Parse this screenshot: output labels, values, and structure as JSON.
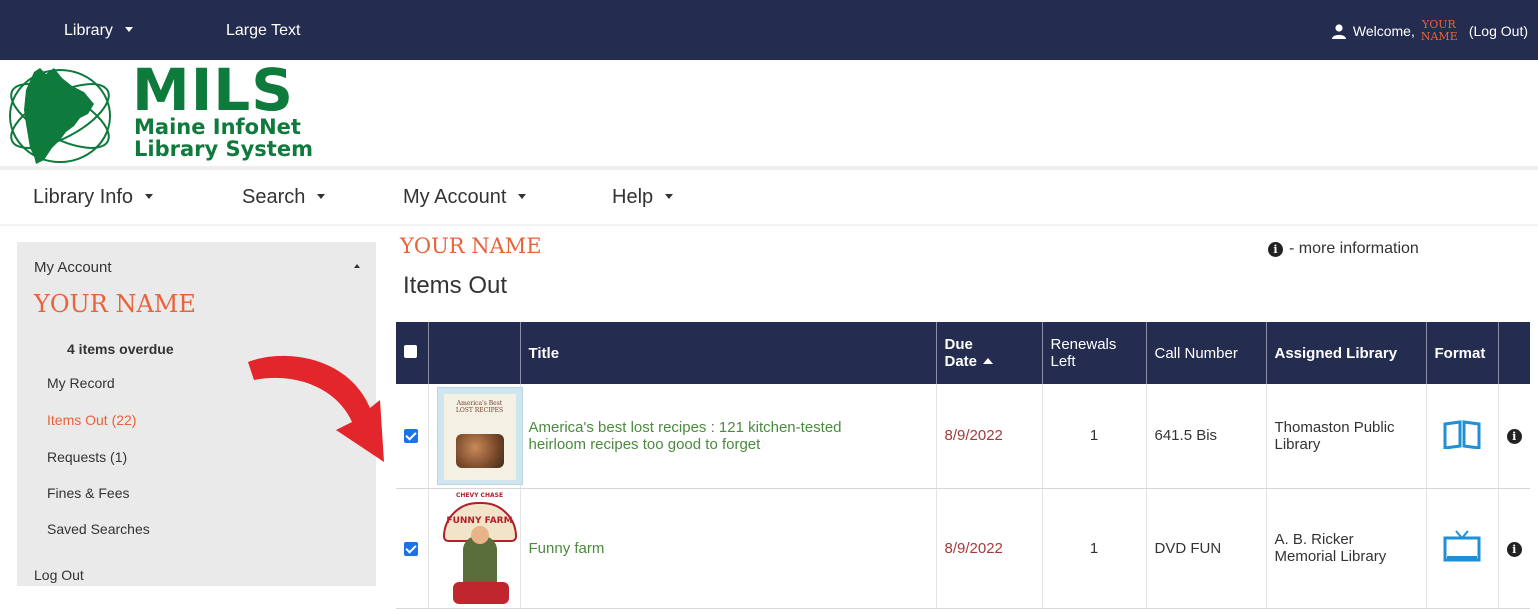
{
  "topbar": {
    "library_label": "Library",
    "large_text_label": "Large Text",
    "welcome_label": "Welcome,",
    "user_name_small": "YOUR NAME",
    "logout_label": "(Log Out)"
  },
  "logo": {
    "line1": "MILS",
    "line2": "Maine InfoNet",
    "line3": "Library System"
  },
  "main_nav": [
    {
      "label": "Library Info"
    },
    {
      "label": "Search"
    },
    {
      "label": "My Account"
    },
    {
      "label": "Help"
    }
  ],
  "sidebar": {
    "title": "My Account",
    "user_name": "YOUR NAME",
    "overdue": "4 items overdue",
    "links": [
      {
        "label": "My Record"
      },
      {
        "label": "Items Out (22)",
        "active": true
      },
      {
        "label": "Requests (1)"
      },
      {
        "label": "Fines & Fees"
      },
      {
        "label": "Saved Searches"
      }
    ],
    "logout": "Log Out"
  },
  "content": {
    "user_name": "YOUR NAME",
    "title": "Items Out",
    "more_info": "- more information"
  },
  "table": {
    "headers": {
      "title": "Title",
      "due_date_1": "Due",
      "due_date_2": "Date",
      "renewals_1": "Renewals",
      "renewals_2": "Left",
      "call_number": "Call Number",
      "assigned_library": "Assigned Library",
      "format": "Format"
    },
    "rows": [
      {
        "checked": true,
        "cover_text": "America's Best LOST RECIPES",
        "title_line1": "America's best lost recipes : 121 kitchen-tested",
        "title_line2": "heirloom recipes too good to forget",
        "due_date": "8/9/2022",
        "renewals_left": "1",
        "call_number": "641.5 Bis",
        "library_line1": "Thomaston Public",
        "library_line2": "Library",
        "format_icon": "book-icon"
      },
      {
        "checked": true,
        "cover_text_top": "CHEVY CHASE",
        "cover_text_sign": "FUNNY FARM",
        "title_line1": "Funny farm",
        "due_date": "8/9/2022",
        "renewals_left": "1",
        "call_number": "DVD FUN",
        "library_line1": "A. B. Ricker",
        "library_line2": "Memorial Library",
        "format_icon": "tv-icon"
      }
    ]
  },
  "colors": {
    "navy": "#242c4f",
    "accent_orange": "#e8623a",
    "logo_green": "#0e7a3b",
    "title_link_green": "#4b8a3f",
    "due_red": "#a33a3a",
    "arrow_red": "#e3262b",
    "format_blue": "#1f8fd6"
  }
}
